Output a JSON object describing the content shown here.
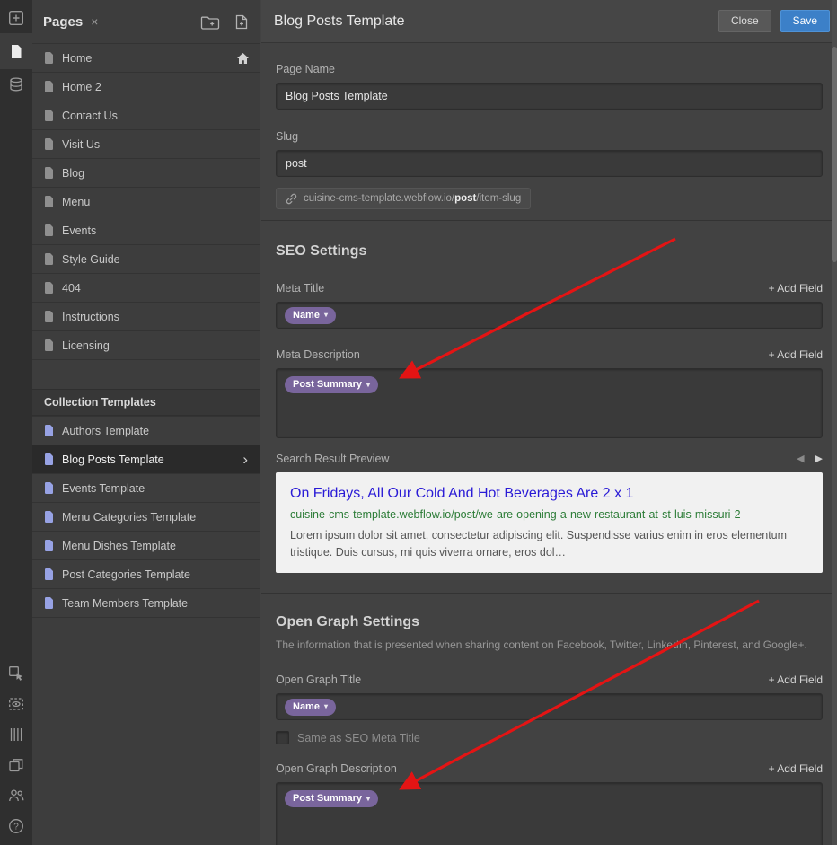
{
  "colors": {
    "save_button": "#3c80c8",
    "field_pill_purple": "#79659c",
    "annotation_arrow_red": "#e41414",
    "preview_title_blue": "#2a1bd6",
    "preview_url_green": "#2c7c37"
  },
  "toolbar_icons": [
    "add-panel",
    "pages-panel-active",
    "cms-collections",
    "select-mode",
    "preview-selection",
    "guides",
    "export-layout",
    "members",
    "help"
  ],
  "sidebar": {
    "title": "Pages",
    "close_icon": "×",
    "pages": [
      {
        "label": "Home",
        "home": true
      },
      {
        "label": "Home 2"
      },
      {
        "label": "Contact Us"
      },
      {
        "label": "Visit Us"
      },
      {
        "label": "Blog"
      },
      {
        "label": "Menu"
      },
      {
        "label": "Events"
      },
      {
        "label": "Style Guide"
      },
      {
        "label": "404"
      },
      {
        "label": "Instructions"
      },
      {
        "label": "Licensing"
      }
    ],
    "collection_header": "Collection Templates",
    "templates": [
      {
        "label": "Authors Template"
      },
      {
        "label": "Blog Posts Template",
        "selected": true
      },
      {
        "label": "Events Template"
      },
      {
        "label": "Menu Categories Template"
      },
      {
        "label": "Menu Dishes Template"
      },
      {
        "label": "Post Categories Template"
      },
      {
        "label": "Team Members Template"
      }
    ]
  },
  "header": {
    "title": "Blog Posts Template",
    "close_label": "Close",
    "save_label": "Save"
  },
  "form": {
    "page_name_label": "Page Name",
    "page_name_value": "Blog Posts Template",
    "slug_label": "Slug",
    "slug_value": "post",
    "url_prefix": "cuisine-cms-template.webflow.io/",
    "url_slug": "post",
    "url_suffix": "/item-slug"
  },
  "labels": {
    "add_field": "+ Add Field"
  },
  "seo": {
    "heading": "SEO Settings",
    "meta_title_label": "Meta Title",
    "meta_title_field": "Name",
    "meta_description_label": "Meta Description",
    "meta_description_field": "Post Summary",
    "preview_label": "Search Result Preview",
    "preview_title": "On Fridays, All Our Cold And Hot Beverages Are 2 x 1",
    "preview_url": "cuisine-cms-template.webflow.io/post/we-are-opening-a-new-restaurant-at-st-luis-missuri-2",
    "preview_description": "Lorem ipsum dolor sit amet, consectetur adipiscing elit. Suspendisse varius enim in eros elementum tristique. Duis cursus, mi quis viverra ornare, eros dol…"
  },
  "open_graph": {
    "heading": "Open Graph Settings",
    "subtitle": "The information that is presented when sharing content on Facebook, Twitter, LinkedIn, Pinterest, and Google+.",
    "title_label": "Open Graph Title",
    "title_field": "Name",
    "same_as_label": "Same as SEO Meta Title",
    "description_label": "Open Graph Description",
    "description_field": "Post Summary"
  }
}
